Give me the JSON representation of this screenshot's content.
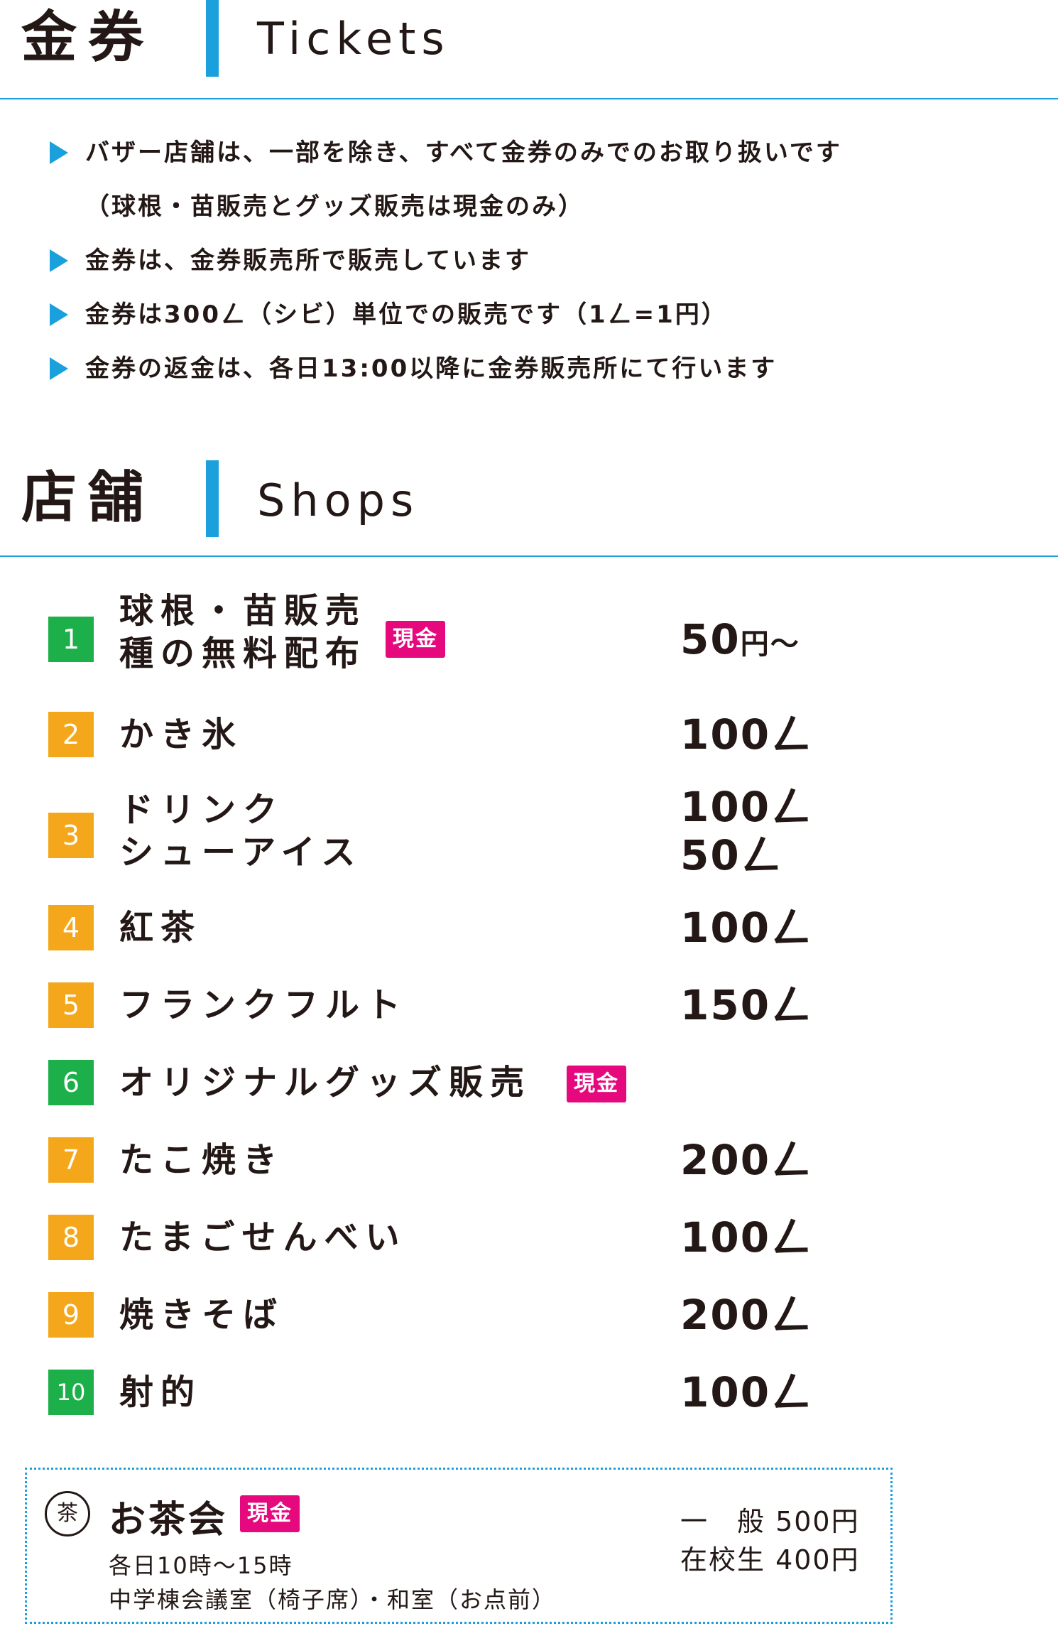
{
  "tickets": {
    "title_jp": "金券",
    "title_en": "Tickets",
    "notes": [
      "バザー店舗は、一部を除き、すべて金券のみでのお取り扱いです",
      "（球根・苗販売とグッズ販売は現金のみ）",
      "金券は、金券販売所で販売しています",
      "金券は300ㄥ（シビ）単位での販売です（1ㄥ=1円）",
      "金券の返金は、各日13:00以降に金券販売所にて行います"
    ]
  },
  "shops": {
    "title_jp": "店舗",
    "title_en": "Shops",
    "cash_label": "現金",
    "colors": {
      "green": "#1db04a",
      "orange": "#f4a71a",
      "cash": "#e6097e",
      "accent": "#1aa0dc"
    },
    "items": [
      {
        "num": "1",
        "name1": "球根・苗販売",
        "name2": "種の無料配布",
        "price1": "50",
        "unit1": "円～"
      },
      {
        "num": "2",
        "name1": "かき氷",
        "price1": "100",
        "unit1": "ㄥ"
      },
      {
        "num": "3",
        "name1": "ドリンク",
        "name2": "シューアイス",
        "price1": "100",
        "unit1": "ㄥ",
        "price2": "50",
        "unit2": "ㄥ"
      },
      {
        "num": "4",
        "name1": "紅茶",
        "price1": "100",
        "unit1": "ㄥ"
      },
      {
        "num": "5",
        "name1": "フランクフルト",
        "price1": "150",
        "unit1": "ㄥ"
      },
      {
        "num": "6",
        "name1": "オリジナルグッズ販売"
      },
      {
        "num": "7",
        "name1": "たこ焼き",
        "price1": "200",
        "unit1": "ㄥ"
      },
      {
        "num": "8",
        "name1": "たまごせんべい",
        "price1": "100",
        "unit1": "ㄥ"
      },
      {
        "num": "9",
        "name1": "焼きそば",
        "price1": "200",
        "unit1": "ㄥ"
      },
      {
        "num": "10",
        "name1": "射的",
        "price1": "100",
        "unit1": "ㄥ"
      }
    ]
  },
  "tea": {
    "title": "お茶会",
    "cash_label": "現金",
    "time": "各日10時～15時",
    "place": "中学棟会議室（椅子席）・和室（お点前）",
    "price_general": "一　般 500円",
    "price_student": "在校生 400円",
    "logo_glyph": "茶"
  }
}
